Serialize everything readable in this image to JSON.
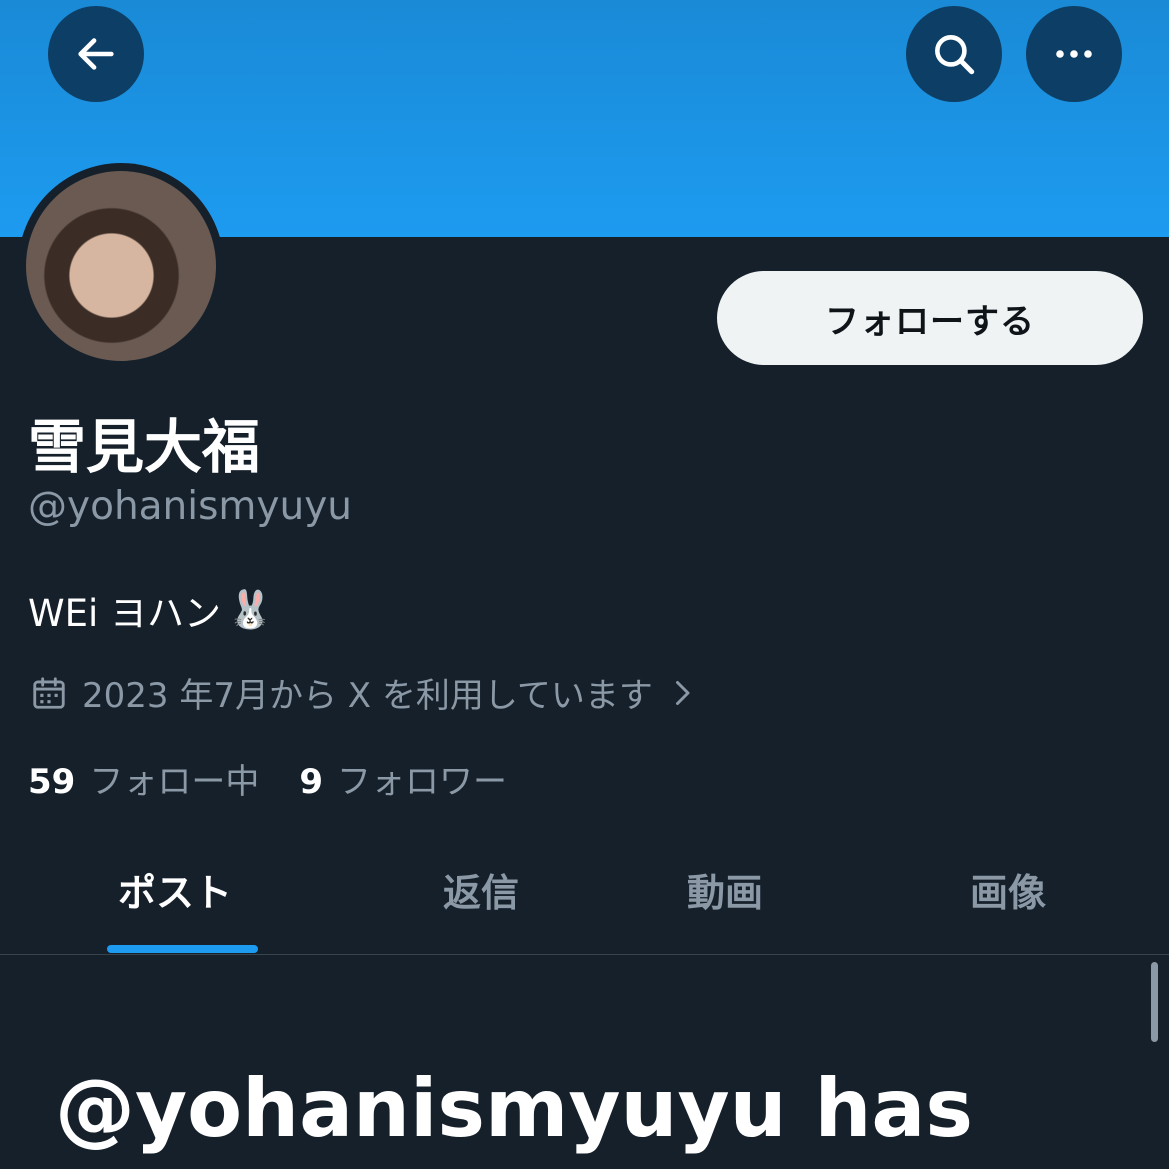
{
  "header": {
    "back_icon": "arrow-left-icon",
    "search_icon": "search-icon",
    "more_icon": "more-horizontal-icon",
    "banner_color": "#1d9bf0"
  },
  "profile": {
    "display_name": "雪見大福",
    "handle": "@yohanismyuyu",
    "bio_text": "WEi ヨハン",
    "bio_emoji": "🐰",
    "joined": "2023 年7月から X を利用しています",
    "follow_button": "フォローする",
    "following_count": "59",
    "following_label": "フォロー中",
    "followers_count": "9",
    "followers_label": "フォロワー"
  },
  "tabs": [
    {
      "label": "ポスト",
      "active": true
    },
    {
      "label": "返信",
      "active": false
    },
    {
      "label": "動画",
      "active": false
    },
    {
      "label": "画像",
      "active": false
    }
  ],
  "notice": "@yohanismyuyu has",
  "colors": {
    "background": "#15202b",
    "accent": "#1d9bf0",
    "muted_text": "#8b98a5"
  }
}
